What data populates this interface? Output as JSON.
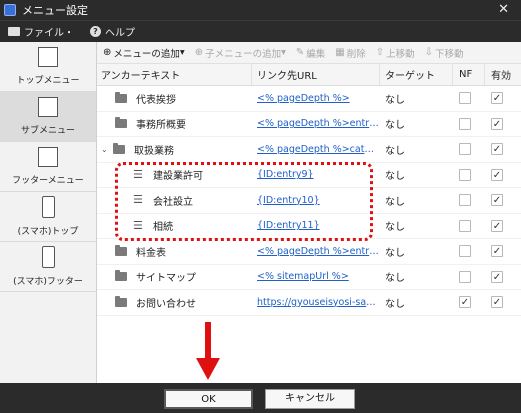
{
  "window": {
    "title": "メニュー設定"
  },
  "menubar": {
    "file": "ファイル・",
    "help": "ヘルプ"
  },
  "sidebar": {
    "items": [
      {
        "label": "トップメニュー"
      },
      {
        "label": "サブメニュー"
      },
      {
        "label": "フッターメニュー"
      },
      {
        "label": "(スマホ)トップ"
      },
      {
        "label": "(スマホ)フッター"
      }
    ]
  },
  "toolbar": {
    "add_menu": "メニューの追加",
    "add_submenu": "子メニューの追加",
    "edit": "編集",
    "delete": "削除",
    "move_up": "上移動",
    "move_down": "下移動"
  },
  "grid": {
    "headers": {
      "anchor": "アンカーテキスト",
      "url": "リンク先URL",
      "target": "ターゲット",
      "nf": "NF",
      "valid": "有効"
    },
    "rows": [
      {
        "anchor": "代表挨拶",
        "url": "<% pageDepth %>",
        "target": "なし",
        "nf": false,
        "valid": true
      },
      {
        "anchor": "事務所概要",
        "url": "<% pageDepth %>entry1.",
        "target": "なし",
        "nf": false,
        "valid": true
      },
      {
        "anchor": "取扱業務",
        "url": "<% pageDepth %>categor",
        "target": "なし",
        "nf": false,
        "valid": true
      },
      {
        "anchor": "建設業許可",
        "url": "{ID:entry9}",
        "target": "なし",
        "nf": false,
        "valid": true
      },
      {
        "anchor": "会社設立",
        "url": "{ID:entry10}",
        "target": "なし",
        "nf": false,
        "valid": true
      },
      {
        "anchor": "相続",
        "url": "{ID:entry11}",
        "target": "なし",
        "nf": false,
        "valid": true
      },
      {
        "anchor": "料金表",
        "url": "<% pageDepth %>entry5.",
        "target": "なし",
        "nf": false,
        "valid": true
      },
      {
        "anchor": "サイトマップ",
        "url": "<% sitemapUrl %>",
        "target": "なし",
        "nf": false,
        "valid": true
      },
      {
        "anchor": "お問い合わせ",
        "url": "https://gyouseisyosi-sample",
        "target": "なし",
        "nf": true,
        "valid": true
      }
    ]
  },
  "footer": {
    "ok": "OK",
    "cancel": "キャンセル"
  },
  "colors": {
    "annotation": "#e01010",
    "link": "#2060c8",
    "chrome": "#2b2b2b"
  }
}
